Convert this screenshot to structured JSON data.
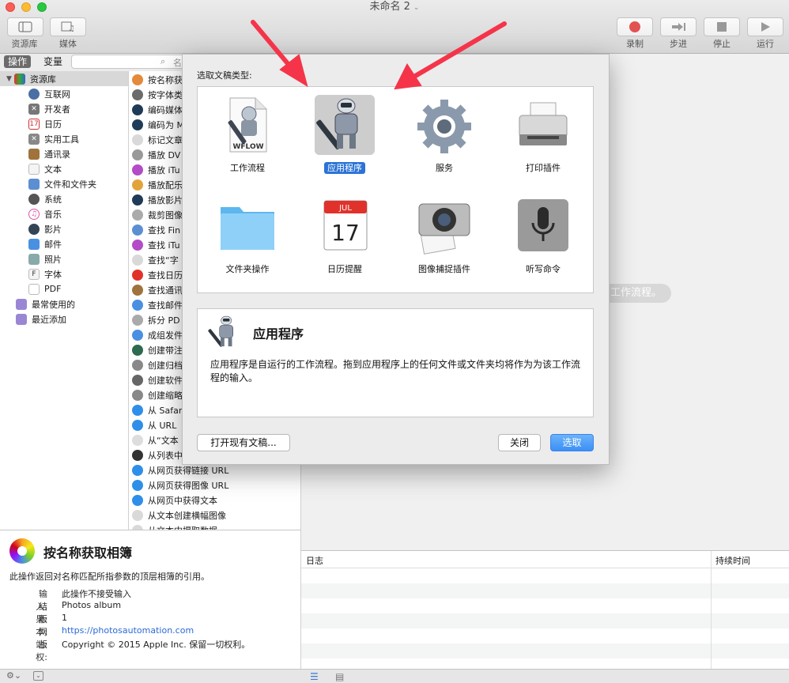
{
  "window": {
    "title": "未命名 2"
  },
  "toolbar": {
    "left": [
      {
        "label": "资源库"
      },
      {
        "label": "媒体"
      }
    ],
    "right": [
      {
        "label": "录制"
      },
      {
        "label": "步进"
      },
      {
        "label": "停止"
      },
      {
        "label": "运行"
      }
    ]
  },
  "tabs": {
    "actions": "操作",
    "variables": "变量"
  },
  "search": {
    "placeholder": "名"
  },
  "library": {
    "root": "资源库",
    "items": [
      "互联网",
      "开发者",
      "日历",
      "实用工具",
      "通讯录",
      "文本",
      "文件和文件夹",
      "系统",
      "音乐",
      "影片",
      "邮件",
      "照片",
      "字体",
      "PDF"
    ],
    "smart": [
      "最常使用的",
      "最近添加"
    ]
  },
  "actions": [
    "按名称获",
    "按字体类",
    "编码媒体",
    "编码为 M",
    "标记文章",
    "播放 DV",
    "播放 iTu",
    "播放配乐",
    "播放影片",
    "裁剪图像",
    "查找 Fin",
    "查找 iTu",
    "查找“字",
    "查找日历",
    "查找通讯",
    "查找邮件",
    "拆分 PD",
    "成组发件",
    "创建带注",
    "创建归档",
    "创建软件",
    "创建缩略",
    "从 Safar",
    "从 URL",
    "从“文本",
    "从列表中",
    "从网页获得链接 URL",
    "从网页获得图像 URL",
    "从网页中获得文本",
    "从文本创建横幅图像",
    "从文本中提取数据"
  ],
  "detail": {
    "title": "按名称获取相簿",
    "description": "此操作返回对名称匹配所指参数的顶层相簿的引用。",
    "rows": [
      {
        "k": "输入:",
        "v": "此操作不接受输入"
      },
      {
        "k": "结果:",
        "v": "Photos album"
      },
      {
        "k": "版本:",
        "v": "1"
      },
      {
        "k": "网站:",
        "v": "https://photosautomation.com"
      },
      {
        "k": "版权:",
        "v": "Copyright © 2015 Apple Inc. 保留一切权利。"
      }
    ]
  },
  "workarea": {
    "hint": "工作流程。"
  },
  "log": {
    "col_log": "日志",
    "col_duration": "持续时间"
  },
  "sheet": {
    "prompt": "选取文稿类型:",
    "types": [
      "工作流程",
      "应用程序",
      "服务",
      "打印插件",
      "文件夹操作",
      "日历提醒",
      "图像捕捉插件",
      "听写命令"
    ],
    "selected_index": 1,
    "info_title": "应用程序",
    "info_desc": "应用程序是自运行的工作流程。拖到应用程序上的任何文件或文件夹均将作为为该工作流程的输入。",
    "wflow_text": "WFLOW",
    "cal_month": "JUL",
    "cal_day": "17",
    "btn_open": "打开现有文稿...",
    "btn_close": "关闭",
    "btn_choose": "选取"
  },
  "colors": {
    "accent": "#2b73d6",
    "arrow": "#f5344a"
  }
}
